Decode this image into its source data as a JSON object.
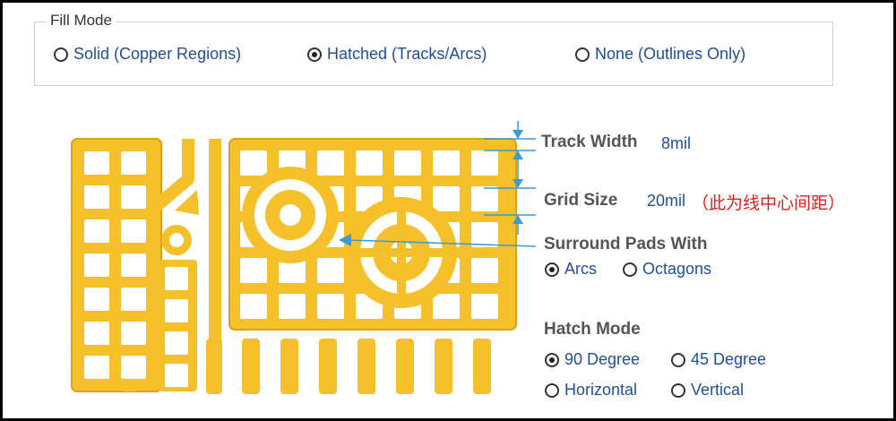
{
  "fill_mode": {
    "title": "Fill Mode",
    "options": [
      {
        "label": "Solid (Copper Regions)",
        "selected": false
      },
      {
        "label": "Hatched (Tracks/Arcs)",
        "selected": true
      },
      {
        "label": "None (Outlines Only)",
        "selected": false
      }
    ]
  },
  "track_width": {
    "label": "Track Width",
    "value": "8mil"
  },
  "grid_size": {
    "label": "Grid Size",
    "value": "20mil",
    "note": "（此为线中心间距）"
  },
  "surround_pads": {
    "label": "Surround Pads With",
    "options": [
      {
        "label": "Arcs",
        "selected": true
      },
      {
        "label": "Octagons",
        "selected": false
      }
    ]
  },
  "hatch_mode": {
    "label": "Hatch Mode",
    "options": [
      {
        "label": "90 Degree",
        "selected": true
      },
      {
        "label": "45 Degree",
        "selected": false
      },
      {
        "label": "Horizontal",
        "selected": false
      },
      {
        "label": "Vertical",
        "selected": false
      }
    ]
  },
  "colors": {
    "copper": "#f6c02a",
    "copper_edge": "#d7a21c",
    "guide_blue": "#3a9ad6",
    "text_blue": "#1f4e9c",
    "note_red": "#e02020"
  }
}
